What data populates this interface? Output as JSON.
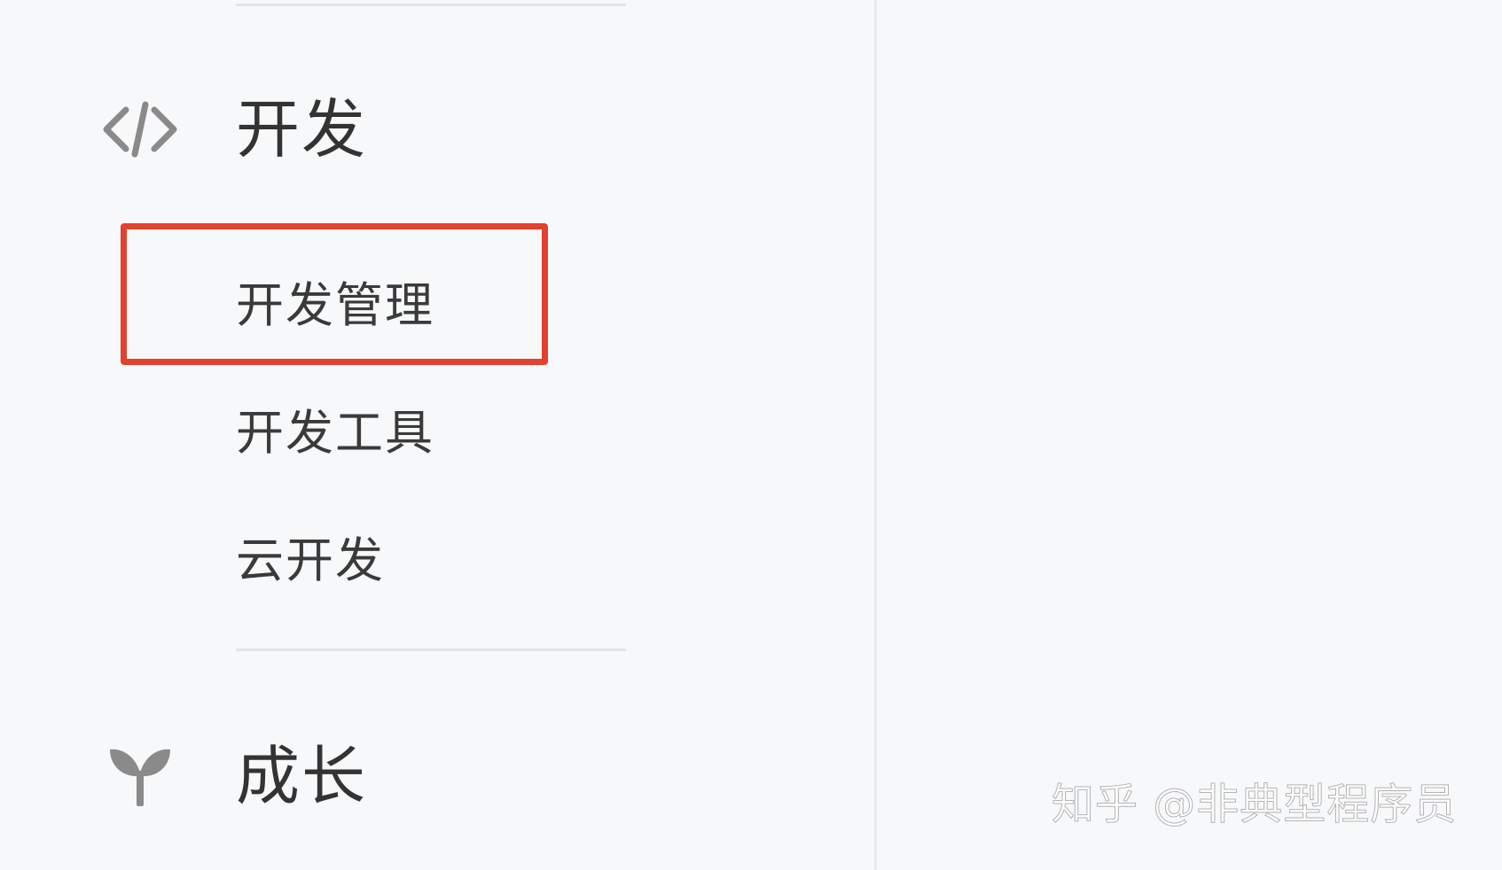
{
  "sidebar": {
    "sections": [
      {
        "icon": "code-icon",
        "title": "开发",
        "items": [
          {
            "label": "开发管理",
            "highlighted": true
          },
          {
            "label": "开发工具",
            "highlighted": false
          },
          {
            "label": "云开发",
            "highlighted": false
          }
        ]
      },
      {
        "icon": "sprout-icon",
        "title": "成长",
        "items": []
      }
    ]
  },
  "annotation": {
    "highlight_color": "#e2412f"
  },
  "watermark": {
    "text": "知乎 @非典型程序员"
  },
  "colors": {
    "background": "#f7f8fa",
    "text": "#333333",
    "icon": "#8a8a8a",
    "divider": "#e3e4e6"
  }
}
